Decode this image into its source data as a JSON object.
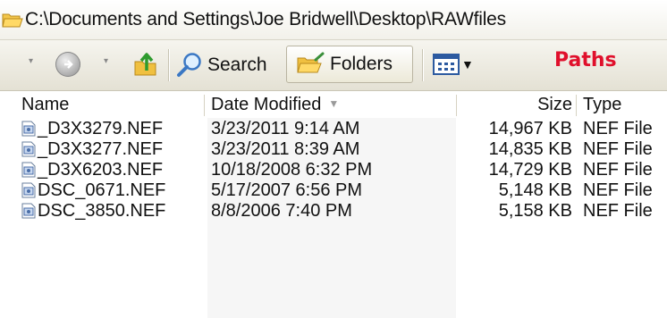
{
  "address_bar": {
    "path": "C:\\Documents and Settings\\Joe Bridwell\\Desktop\\RAWfiles"
  },
  "toolbar": {
    "search_label": "Search",
    "folders_label": "Folders",
    "annotation": "Paths"
  },
  "columns": {
    "name": "Name",
    "date_modified": "Date Modified",
    "size": "Size",
    "type": "Type"
  },
  "files": [
    {
      "name": "_D3X3279.NEF",
      "date": "3/23/2011 9:14 AM",
      "size": "14,967 KB",
      "type": "NEF File"
    },
    {
      "name": "_D3X3277.NEF",
      "date": "3/23/2011 8:39 AM",
      "size": "14,835 KB",
      "type": "NEF File"
    },
    {
      "name": "_D3X6203.NEF",
      "date": "10/18/2008 6:32 PM",
      "size": "14,729 KB",
      "type": "NEF File"
    },
    {
      "name": "DSC_0671.NEF",
      "date": "5/17/2007 6:56 PM",
      "size": "5,148 KB",
      "type": "NEF File"
    },
    {
      "name": "DSC_3850.NEF",
      "date": "8/8/2006 7:40 PM",
      "size": "5,158 KB",
      "type": "NEF File"
    }
  ],
  "colors": {
    "annotation": "#e0102c",
    "sorted_column": "#f6f6f6"
  }
}
